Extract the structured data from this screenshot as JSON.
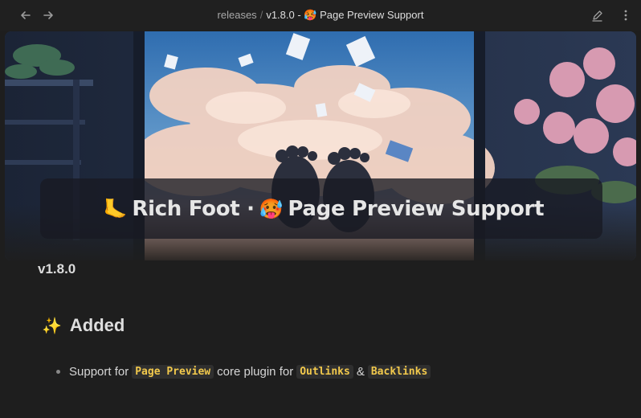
{
  "titlebar": {
    "back_icon": "arrow-left-icon",
    "forward_icon": "arrow-right-icon",
    "breadcrumb_parent": "releases",
    "breadcrumb_sep": "/",
    "breadcrumb_current": "v1.8.0 - 🥵 Page Preview Support",
    "edit_icon": "pencil-icon",
    "more_icon": "more-vertical-icon"
  },
  "banner": {
    "title_prefix_emoji": "🦶",
    "title_part1": "Rich Foot ·",
    "title_mid_emoji": "🥵",
    "title_part2": "Page Preview Support"
  },
  "content": {
    "version": "v1.8.0",
    "section_icon": "✨",
    "section_heading": "Added",
    "bullet": {
      "text1": "Support for",
      "code1": "Page Preview",
      "text2": "core plugin for",
      "code2": "Outlinks",
      "text3": "&",
      "code3": "Backlinks"
    }
  },
  "colors": {
    "background": "#1e1e1e",
    "inline_code": "#f2c94c",
    "text": "#dcddde"
  }
}
